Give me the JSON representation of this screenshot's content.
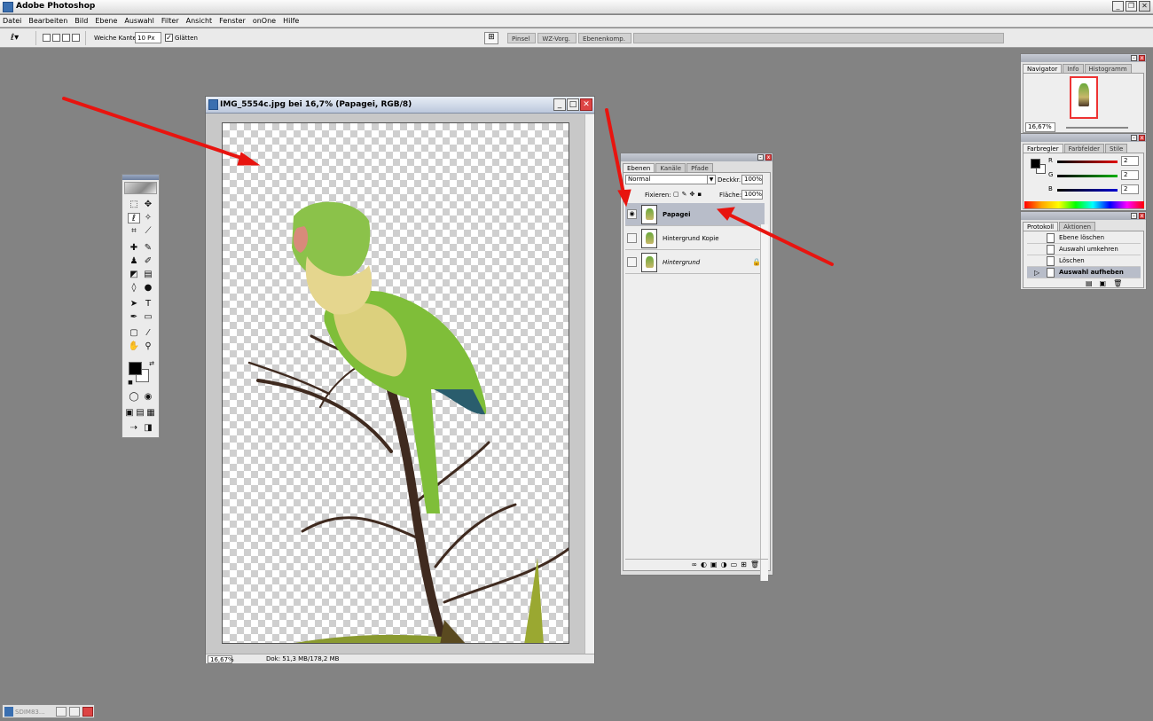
{
  "app": {
    "title": "Adobe Photoshop"
  },
  "menu": [
    "Datei",
    "Bearbeiten",
    "Bild",
    "Ebene",
    "Auswahl",
    "Filter",
    "Ansicht",
    "Fenster",
    "onOne",
    "Hilfe"
  ],
  "options": {
    "feather_label": "Weiche Kante:",
    "feather_value": "10 Px",
    "antialias_label": "Glätten",
    "antialias_checked": true,
    "palette_well": [
      "Pinsel",
      "WZ-Vorg.",
      "Ebenenkomp."
    ]
  },
  "document": {
    "title": "IMG_5554c.jpg bei 16,7% (Papagei, RGB/8)",
    "zoom": "16,67%",
    "doc_info": "Dok: 51,3 MB/178,2 MB"
  },
  "layers_panel": {
    "tabs": [
      "Ebenen",
      "Kanäle",
      "Pfade"
    ],
    "blend_mode": "Normal",
    "opacity_label": "Deckkr.:",
    "opacity_value": "100%",
    "lock_label": "Fixieren:",
    "fill_label": "Fläche:",
    "fill_value": "100%",
    "layers": [
      {
        "name": "Papagei",
        "visible": true,
        "selected": true
      },
      {
        "name": "Hintergrund Kopie",
        "visible": false,
        "selected": false
      },
      {
        "name": "Hintergrund",
        "visible": false,
        "selected": false,
        "locked": true
      }
    ]
  },
  "navigator_panel": {
    "tabs": [
      "Navigator",
      "Info",
      "Histogramm"
    ],
    "zoom": "16,67%"
  },
  "color_panel": {
    "tabs": [
      "Farbregler",
      "Farbfelder",
      "Stile"
    ],
    "channels": [
      {
        "label": "R",
        "value": "2",
        "color": "#e00000"
      },
      {
        "label": "G",
        "value": "2",
        "color": "#00b000"
      },
      {
        "label": "B",
        "value": "2",
        "color": "#0000d0"
      }
    ]
  },
  "history_panel": {
    "tabs": [
      "Protokoll",
      "Aktionen"
    ],
    "items": [
      {
        "label": "Ebene löschen",
        "selected": false
      },
      {
        "label": "Auswahl umkehren",
        "selected": false
      },
      {
        "label": "Löschen",
        "selected": false
      },
      {
        "label": "Auswahl aufheben",
        "selected": true
      }
    ]
  },
  "taskbar": {
    "label": "SDIM83..."
  },
  "colors": {
    "annotation_arrow": "#e8140f",
    "workspace": "#838383"
  }
}
